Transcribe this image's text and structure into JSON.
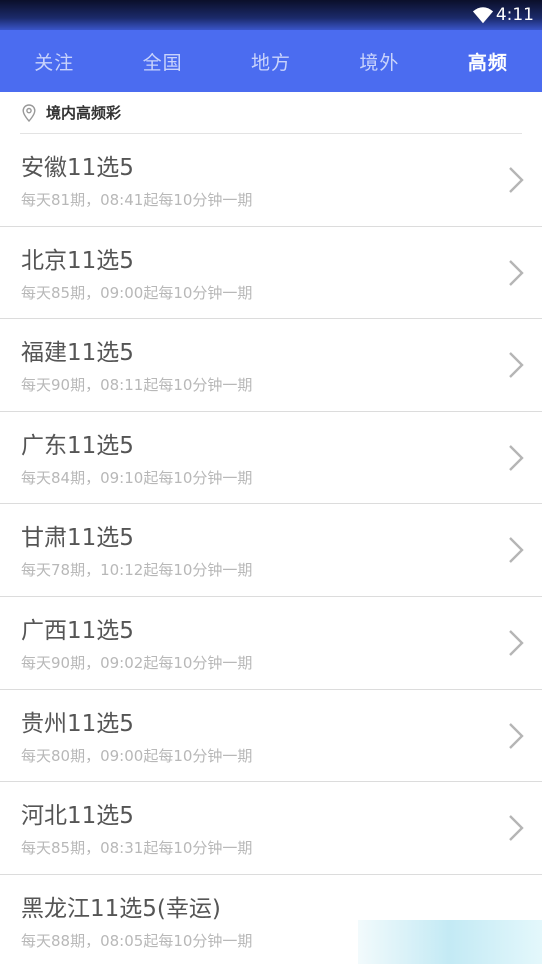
{
  "status_bar": {
    "time": "4:11",
    "wifi_icon": "wifi-icon"
  },
  "tabs": [
    {
      "label": "关注",
      "active": false
    },
    {
      "label": "全国",
      "active": false
    },
    {
      "label": "地方",
      "active": false
    },
    {
      "label": "境外",
      "active": false
    },
    {
      "label": "高频",
      "active": true
    }
  ],
  "section": {
    "icon": "location-pin-icon",
    "title": "境内高频彩"
  },
  "lotteries": [
    {
      "name": "安徽11选5",
      "desc": "每天81期，08:41起每10分钟一期"
    },
    {
      "name": "北京11选5",
      "desc": "每天85期，09:00起每10分钟一期"
    },
    {
      "name": "福建11选5",
      "desc": "每天90期，08:11起每10分钟一期"
    },
    {
      "name": "广东11选5",
      "desc": "每天84期，09:10起每10分钟一期"
    },
    {
      "name": "甘肃11选5",
      "desc": "每天78期，10:12起每10分钟一期"
    },
    {
      "name": "广西11选5",
      "desc": "每天90期，09:02起每10分钟一期"
    },
    {
      "name": "贵州11选5",
      "desc": "每天80期，09:00起每10分钟一期"
    },
    {
      "name": "河北11选5",
      "desc": "每天85期，08:31起每10分钟一期"
    },
    {
      "name": "黑龙江11选5(幸运)",
      "desc": "每天88期，08:05起每10分钟一期"
    }
  ],
  "colors": {
    "accent": "#4b6cf0",
    "tab_inactive": "#c9d3fb",
    "title_text": "#555555",
    "desc_text": "#b8b8b8"
  }
}
